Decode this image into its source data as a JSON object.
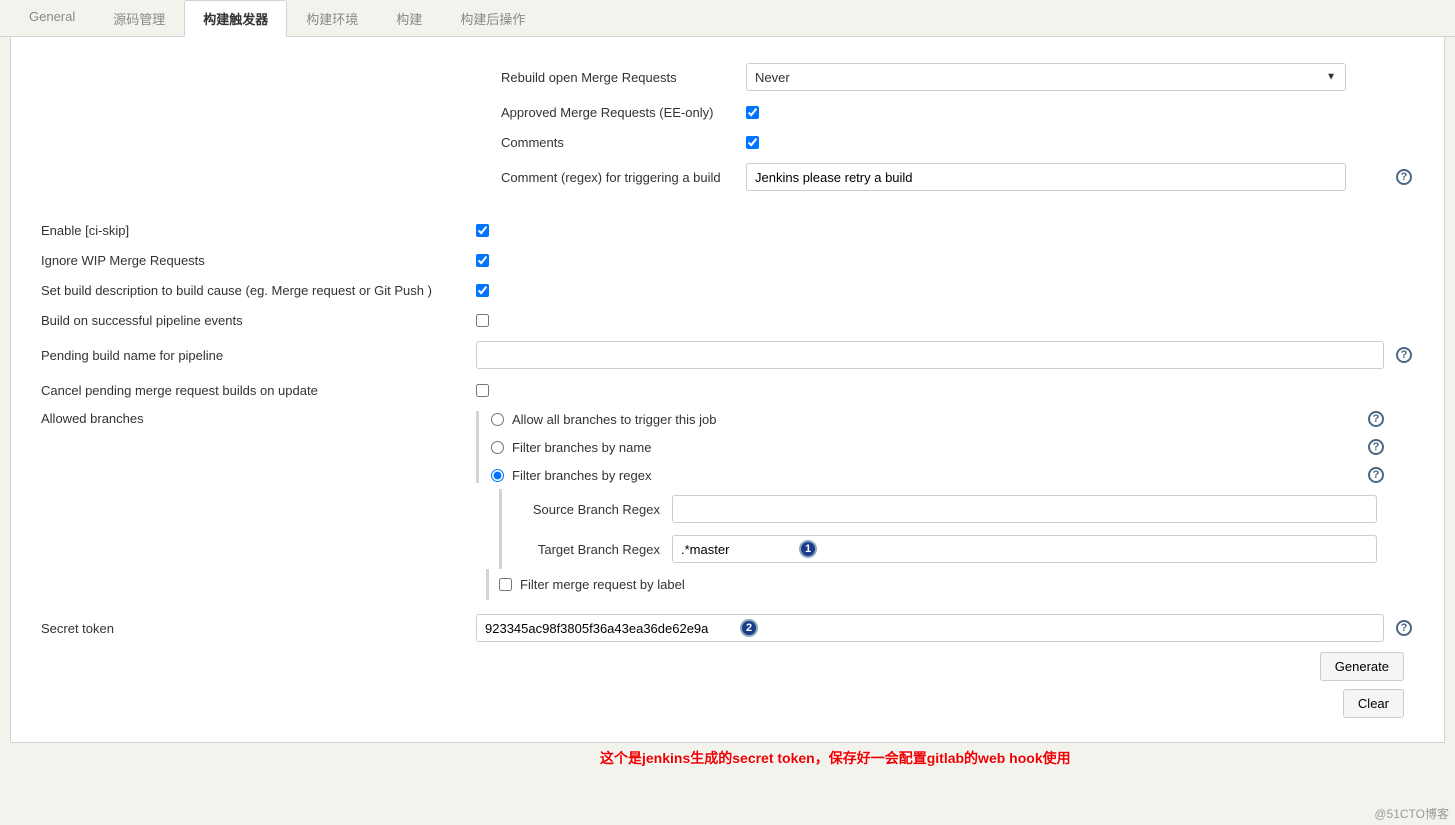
{
  "tabs": {
    "general": "General",
    "scm": "源码管理",
    "triggers": "构建触发器",
    "env": "构建环境",
    "build": "构建",
    "post": "构建后操作"
  },
  "active_tab": "triggers",
  "form": {
    "rebuild_open_mr_label": "Rebuild open Merge Requests",
    "rebuild_open_mr_value": "Never",
    "approved_mr_label": "Approved Merge Requests (EE-only)",
    "approved_mr_checked": true,
    "comments_label": "Comments",
    "comments_checked": true,
    "comment_regex_label": "Comment (regex) for triggering a build",
    "comment_regex_value": "Jenkins please retry a build",
    "enable_ciskip_label": "Enable [ci-skip]",
    "enable_ciskip_checked": true,
    "ignore_wip_label": "Ignore WIP Merge Requests",
    "ignore_wip_checked": true,
    "set_desc_label": "Set build description to build cause (eg. Merge request or Git Push )",
    "set_desc_checked": true,
    "build_pipeline_label": "Build on successful pipeline events",
    "build_pipeline_checked": false,
    "pending_name_label": "Pending build name for pipeline",
    "pending_name_value": "",
    "cancel_pending_label": "Cancel pending merge request builds on update",
    "cancel_pending_checked": false,
    "allowed_branches_label": "Allowed branches",
    "branch_opts": {
      "allow_all": "Allow all branches to trigger this job",
      "by_name": "Filter branches by name",
      "by_regex": "Filter branches by regex"
    },
    "branch_selected": "by_regex",
    "source_regex_label": "Source Branch Regex",
    "source_regex_value": "",
    "target_regex_label": "Target Branch Regex",
    "target_regex_value": ".*master",
    "filter_label_label": "Filter merge request by label",
    "filter_label_checked": false,
    "secret_label": "Secret token",
    "secret_value": "923345ac98f3805f36a43ea36de62e9a",
    "generate_btn": "Generate",
    "clear_btn": "Clear"
  },
  "annotations": {
    "callout_1": "1",
    "callout_2": "2",
    "red_note": "这个是jenkins生成的secret token，保存好一会配置gitlab的web hook使用"
  },
  "watermark": "@51CTO博客",
  "help_glyph": "?"
}
